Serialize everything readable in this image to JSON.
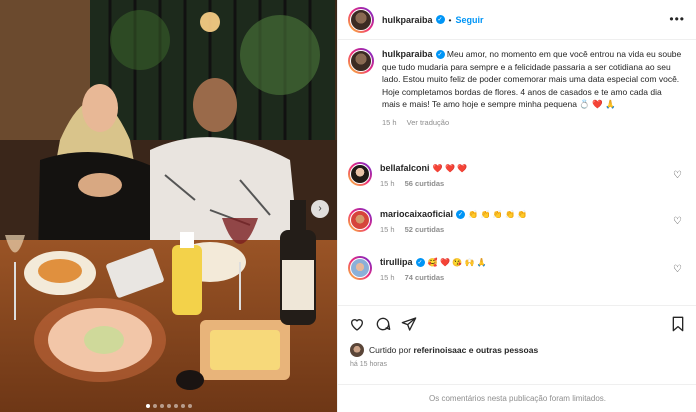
{
  "header": {
    "username": "hulkparaiba",
    "separator": "•",
    "follow_label": "Seguir",
    "more_label": "•••"
  },
  "caption": {
    "username": "hulkparaiba",
    "text": "Meu amor, no momento em que você entrou na vida eu soube que tudo mudaria para sempre e a felicidade passaria a ser cotidiana ao seu lado. Estou muito feliz de poder comemorar mais uma data especial com você. Hoje completamos bordas de flores. 4 anos de casados e te amo cada dia mais e mais! Te amo hoje e sempre minha pequena 💍 ❤️ 🙏",
    "time": "15 h",
    "translate_label": "Ver tradução"
  },
  "comments": [
    {
      "username": "bellafalconi",
      "text": "❤️ ❤️ ❤️",
      "time": "15 h",
      "likes": "56 curtidas",
      "verified": false
    },
    {
      "username": "mariocaixaoficial",
      "text": "👏 👏 👏 👏 👏",
      "time": "15 h",
      "likes": "52 curtidas",
      "verified": true
    },
    {
      "username": "tirullipa",
      "text": "🥰 ❤️ 😘 🙌 🙏",
      "time": "15 h",
      "likes": "74 curtidas",
      "verified": true
    }
  ],
  "likes_row": {
    "prefix": "Curtido por",
    "user": "referinoisaac",
    "suffix": "e outras pessoas"
  },
  "posted_ago": "há 15 horas",
  "comments_limited": "Os comentários nesta publicação foram limitados.",
  "icons": {
    "verified": "verified-badge-icon",
    "like": "heart-icon",
    "comment": "comment-icon",
    "share": "share-icon",
    "save": "bookmark-icon",
    "next": "chevron-right-icon"
  },
  "colors": {
    "accent": "#0095f6",
    "muted": "#8e8e8e",
    "heart": "#ed4956"
  }
}
